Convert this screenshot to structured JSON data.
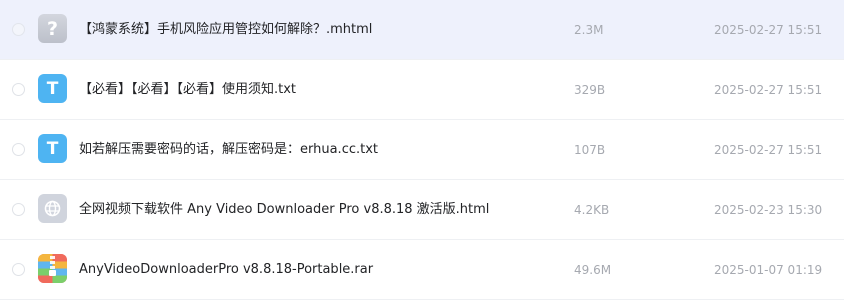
{
  "files": [
    {
      "name": "【鸿蒙系统】手机风险应用管控如何解除？.mhtml",
      "size": "2.3M",
      "date": "2025-02-27 15:51",
      "icon": "unknown-file-icon",
      "icon_glyph": "?",
      "selected": true
    },
    {
      "name": "【必看】【必看】【必看】使用须知.txt",
      "size": "329B",
      "date": "2025-02-27 15:51",
      "icon": "text-file-icon",
      "icon_glyph": "T",
      "selected": false
    },
    {
      "name": "如若解压需要密码的话，解压密码是：erhua.cc.txt",
      "size": "107B",
      "date": "2025-02-27 15:51",
      "icon": "text-file-icon",
      "icon_glyph": "T",
      "selected": false
    },
    {
      "name": "全网视频下载软件 Any Video Downloader Pro v8.8.18 激活版.html",
      "size": "4.2KB",
      "date": "2025-02-23 15:30",
      "icon": "web-file-icon",
      "icon_glyph": "",
      "selected": false
    },
    {
      "name": "AnyVideoDownloaderPro v8.8.18-Portable.rar",
      "size": "49.6M",
      "date": "2025-01-07 01:19",
      "icon": "archive-file-icon",
      "icon_glyph": "",
      "selected": false
    }
  ],
  "colors": {
    "selected_row_bg": "#eef1fc",
    "txt_icon": "#4eb4f2",
    "unknown_icon": "#c8cbd3",
    "meta_text": "#a6a9b0"
  }
}
